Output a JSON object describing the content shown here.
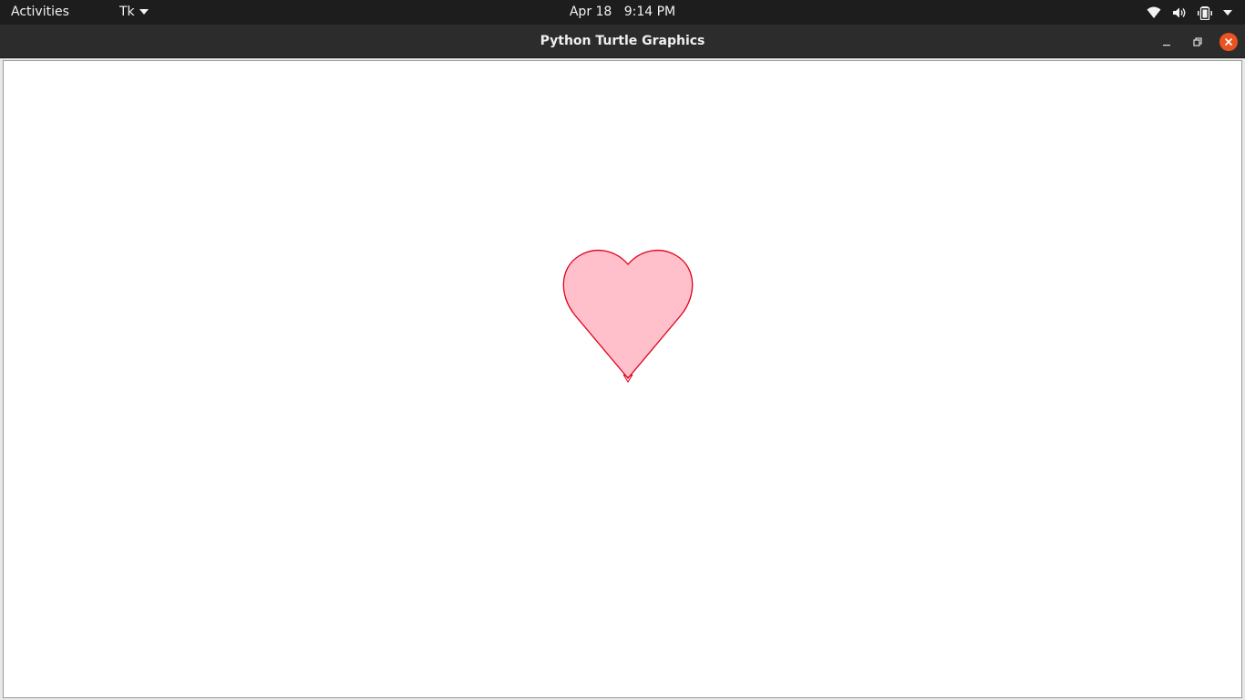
{
  "topbar": {
    "activities_label": "Activities",
    "app_menu_label": "Tk",
    "date": "Apr 18",
    "time": "9:14 PM",
    "tray_icons": [
      "wifi-icon",
      "volume-icon",
      "battery-icon",
      "system-menu-chevron-icon"
    ]
  },
  "window": {
    "title": "Python Turtle Graphics",
    "buttons": [
      "minimize",
      "maximize",
      "close"
    ]
  },
  "canvas": {
    "background": "#ffffff",
    "drawing": {
      "shape": "heart",
      "fill_color": "#ffc0cb",
      "outline_color": "#e0001a",
      "cursor": "turtle-arrow-cursor"
    }
  },
  "colors": {
    "topbar_bg": "#1d1d1d",
    "titlebar_bg": "#2c2c2c",
    "close_button": "#e95420"
  }
}
